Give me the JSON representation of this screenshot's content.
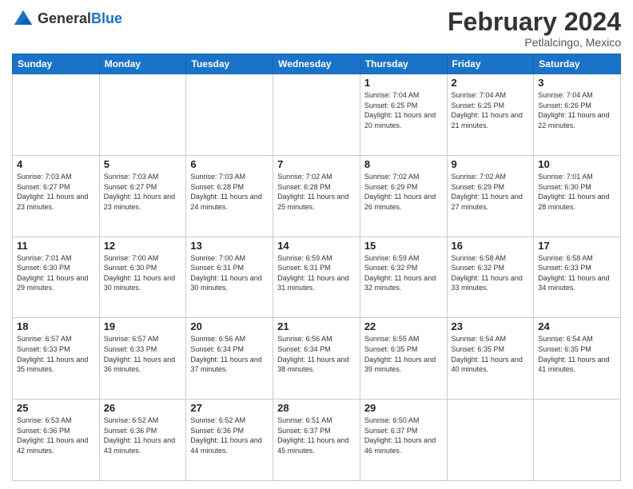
{
  "header": {
    "logo_line1": "General",
    "logo_line2": "Blue",
    "month_title": "February 2024",
    "location": "Petlalcingo, Mexico"
  },
  "days_of_week": [
    "Sunday",
    "Monday",
    "Tuesday",
    "Wednesday",
    "Thursday",
    "Friday",
    "Saturday"
  ],
  "weeks": [
    [
      {
        "day": "",
        "info": ""
      },
      {
        "day": "",
        "info": ""
      },
      {
        "day": "",
        "info": ""
      },
      {
        "day": "",
        "info": ""
      },
      {
        "day": "1",
        "info": "Sunrise: 7:04 AM\nSunset: 6:25 PM\nDaylight: 11 hours\nand 20 minutes."
      },
      {
        "day": "2",
        "info": "Sunrise: 7:04 AM\nSunset: 6:25 PM\nDaylight: 11 hours\nand 21 minutes."
      },
      {
        "day": "3",
        "info": "Sunrise: 7:04 AM\nSunset: 6:26 PM\nDaylight: 11 hours\nand 22 minutes."
      }
    ],
    [
      {
        "day": "4",
        "info": "Sunrise: 7:03 AM\nSunset: 6:27 PM\nDaylight: 11 hours\nand 23 minutes."
      },
      {
        "day": "5",
        "info": "Sunrise: 7:03 AM\nSunset: 6:27 PM\nDaylight: 11 hours\nand 23 minutes."
      },
      {
        "day": "6",
        "info": "Sunrise: 7:03 AM\nSunset: 6:28 PM\nDaylight: 11 hours\nand 24 minutes."
      },
      {
        "day": "7",
        "info": "Sunrise: 7:02 AM\nSunset: 6:28 PM\nDaylight: 11 hours\nand 25 minutes."
      },
      {
        "day": "8",
        "info": "Sunrise: 7:02 AM\nSunset: 6:29 PM\nDaylight: 11 hours\nand 26 minutes."
      },
      {
        "day": "9",
        "info": "Sunrise: 7:02 AM\nSunset: 6:29 PM\nDaylight: 11 hours\nand 27 minutes."
      },
      {
        "day": "10",
        "info": "Sunrise: 7:01 AM\nSunset: 6:30 PM\nDaylight: 11 hours\nand 28 minutes."
      }
    ],
    [
      {
        "day": "11",
        "info": "Sunrise: 7:01 AM\nSunset: 6:30 PM\nDaylight: 11 hours\nand 29 minutes."
      },
      {
        "day": "12",
        "info": "Sunrise: 7:00 AM\nSunset: 6:30 PM\nDaylight: 11 hours\nand 30 minutes."
      },
      {
        "day": "13",
        "info": "Sunrise: 7:00 AM\nSunset: 6:31 PM\nDaylight: 11 hours\nand 30 minutes."
      },
      {
        "day": "14",
        "info": "Sunrise: 6:59 AM\nSunset: 6:31 PM\nDaylight: 11 hours\nand 31 minutes."
      },
      {
        "day": "15",
        "info": "Sunrise: 6:59 AM\nSunset: 6:32 PM\nDaylight: 11 hours\nand 32 minutes."
      },
      {
        "day": "16",
        "info": "Sunrise: 6:58 AM\nSunset: 6:32 PM\nDaylight: 11 hours\nand 33 minutes."
      },
      {
        "day": "17",
        "info": "Sunrise: 6:58 AM\nSunset: 6:33 PM\nDaylight: 11 hours\nand 34 minutes."
      }
    ],
    [
      {
        "day": "18",
        "info": "Sunrise: 6:57 AM\nSunset: 6:33 PM\nDaylight: 11 hours\nand 35 minutes."
      },
      {
        "day": "19",
        "info": "Sunrise: 6:57 AM\nSunset: 6:33 PM\nDaylight: 11 hours\nand 36 minutes."
      },
      {
        "day": "20",
        "info": "Sunrise: 6:56 AM\nSunset: 6:34 PM\nDaylight: 11 hours\nand 37 minutes."
      },
      {
        "day": "21",
        "info": "Sunrise: 6:56 AM\nSunset: 6:34 PM\nDaylight: 11 hours\nand 38 minutes."
      },
      {
        "day": "22",
        "info": "Sunrise: 6:55 AM\nSunset: 6:35 PM\nDaylight: 11 hours\nand 39 minutes."
      },
      {
        "day": "23",
        "info": "Sunrise: 6:54 AM\nSunset: 6:35 PM\nDaylight: 11 hours\nand 40 minutes."
      },
      {
        "day": "24",
        "info": "Sunrise: 6:54 AM\nSunset: 6:35 PM\nDaylight: 11 hours\nand 41 minutes."
      }
    ],
    [
      {
        "day": "25",
        "info": "Sunrise: 6:53 AM\nSunset: 6:36 PM\nDaylight: 11 hours\nand 42 minutes."
      },
      {
        "day": "26",
        "info": "Sunrise: 6:52 AM\nSunset: 6:36 PM\nDaylight: 11 hours\nand 43 minutes."
      },
      {
        "day": "27",
        "info": "Sunrise: 6:52 AM\nSunset: 6:36 PM\nDaylight: 11 hours\nand 44 minutes."
      },
      {
        "day": "28",
        "info": "Sunrise: 6:51 AM\nSunset: 6:37 PM\nDaylight: 11 hours\nand 45 minutes."
      },
      {
        "day": "29",
        "info": "Sunrise: 6:50 AM\nSunset: 6:37 PM\nDaylight: 11 hours\nand 46 minutes."
      },
      {
        "day": "",
        "info": ""
      },
      {
        "day": "",
        "info": ""
      }
    ]
  ]
}
